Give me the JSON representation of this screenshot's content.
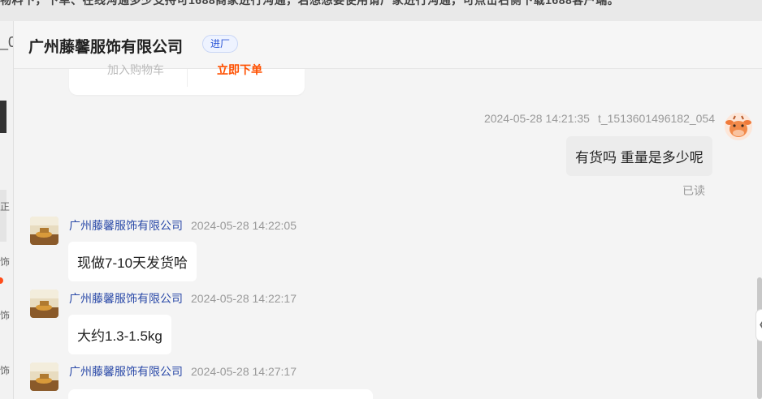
{
  "background": {
    "top_text": "物料下，下单、在线沟通多少支持可1688商家进行沟通，若想想要使用请广家进行沟通，可点击右侧下载1688客户端。",
    "left_fragments": [
      "_0",
      "正",
      "饰",
      "饰",
      "饰"
    ]
  },
  "header": {
    "title": "广州藤馨服饰有限公司",
    "tag": "进厂"
  },
  "previous_card": {
    "left_label": "加入购物车",
    "right_label": "立即下单"
  },
  "messages": {
    "me": {
      "time": "2024-05-28 14:21:35",
      "user_id": "t_1513601496182_054",
      "text": "有货吗 重量是多少呢",
      "read_status": "已读"
    },
    "shop": [
      {
        "sender": "广州藤馨服饰有限公司",
        "time": "2024-05-28 14:22:05",
        "text": "现做7-10天发货哈"
      },
      {
        "sender": "广州藤馨服饰有限公司",
        "time": "2024-05-28 14:22:17",
        "text": "大约1.3-1.5kg"
      },
      {
        "sender": "广州藤馨服饰有限公司",
        "time": "2024-05-28 14:27:17",
        "text": ""
      }
    ]
  },
  "colors": {
    "accent_blue": "#2b55d6",
    "sender_name": "#2b4aa8",
    "order_orange": "#ff5000",
    "panel_bg": "#f4f4f4"
  },
  "icons": {
    "me_avatar": "cow-avatar-icon",
    "shop_avatar": "shop-logo-icon",
    "collapse": "chevron-left-icon"
  }
}
